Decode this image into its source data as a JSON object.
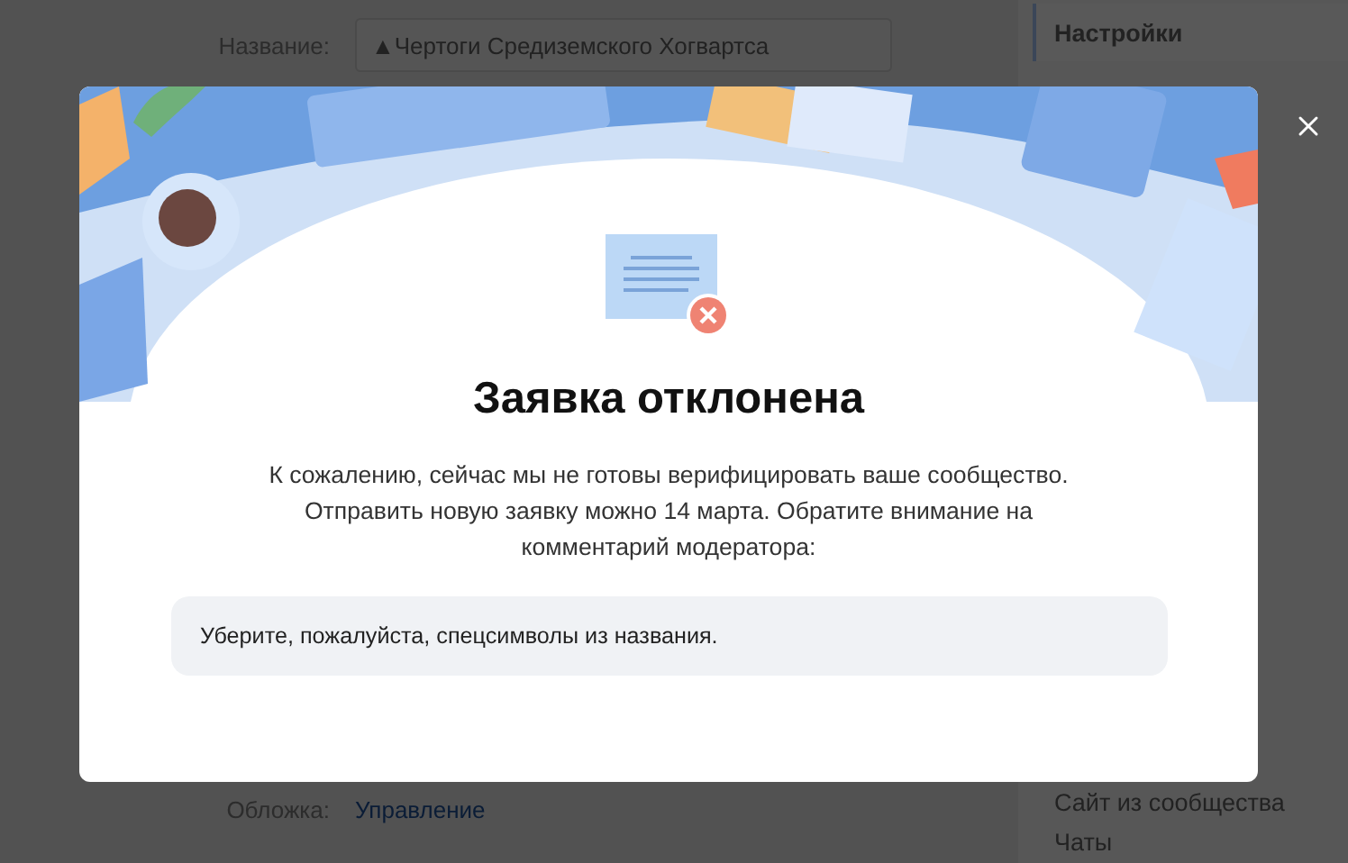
{
  "background_page": {
    "name_field": {
      "label": "Название:",
      "value": "▲Чертоги Средиземского Хогвартса"
    },
    "cover_field": {
      "label": "Обложка:",
      "link": "Управление"
    },
    "sidebar": {
      "items": [
        {
          "label": "Настройки",
          "selected": true
        },
        {
          "label": "Сайт из сообщества",
          "selected": false
        },
        {
          "label": "Чаты",
          "selected": false
        }
      ]
    }
  },
  "modal": {
    "title": "Заявка отклонена",
    "message": "К сожалению, сейчас мы не готовы верифицировать ваше сообщество. Отправить новую заявку можно 14 марта. Обратите внимание на комментарий модератора:",
    "comment": "Уберите, пожалуйста, спецсимволы из названия."
  }
}
